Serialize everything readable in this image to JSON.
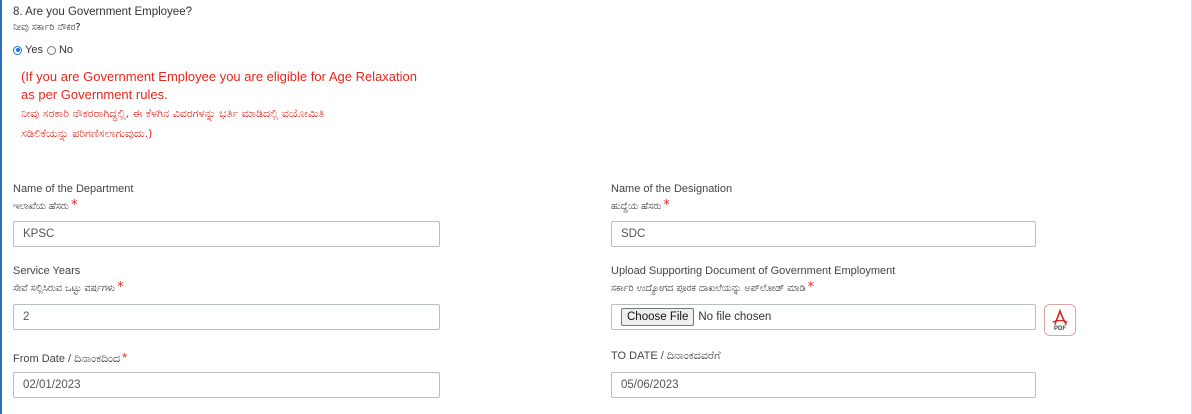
{
  "question": {
    "label": "8. Are you Government Employee?",
    "label_kn": "ನೀವು ಸರ್ಕಾರಿ ನೌಕರ?",
    "options": [
      {
        "label": "Yes",
        "checked": true
      },
      {
        "label": "No",
        "checked": false
      }
    ]
  },
  "notice": {
    "line1": "(If you are Government Employee you are eligible for Age Relaxation",
    "line2": "as per Government rules.",
    "line3": "ನೀವು ಸರಕಾರಿ ನೌಕರರಾಗಿದ್ದಲ್ಲಿ, ಈ ಕೆಳಗಿನ ವಿವರಗಳನ್ನು ಭರ್ತಿ ಮಾಡಿದಲ್ಲಿ ವಯೋಮಿತಿ",
    "line4": "ಸಡಿಲಿಕೆಯನ್ನು ಪರಿಗಣಿಸಲಾಗುವುದು.)"
  },
  "fields": {
    "department": {
      "label": "Name of the Department",
      "label_kn": "ಇಲಾಖೆಯ ಹೆಸರು",
      "required": "*",
      "value": "KPSC"
    },
    "designation": {
      "label": "Name of the Designation",
      "label_kn": "ಹುದ್ದೆಯ ಹೆಸರು",
      "required": "*",
      "value": "SDC"
    },
    "service_years": {
      "label": "Service Years",
      "label_kn": "ಸೇವೆ ಸಲ್ಲಿಸಿರುವ ಒಟ್ಟು ವರ್ಷಗಳು",
      "required": "*",
      "value": "2"
    },
    "upload": {
      "label": "Upload Supporting Document of Government Employment",
      "label_kn": "ಸರ್ಕಾರಿ ಉದ್ಯೋಗದ ಪೂರಕ ದಾಖಲೆಯನ್ನು ಅಪ್‌ಲೋಡ್ ಮಾಡಿ",
      "required": "*",
      "button": "Choose File",
      "status": "No file chosen",
      "icon_text": "PDF"
    },
    "from_date": {
      "label": "From Date / ದಿನಾಂಕದಿಂದ",
      "required": "*",
      "value": "02/01/2023"
    },
    "to_date": {
      "label": "TO DATE / ದಿನಾಂಕದವರೆಗೆ",
      "value": "05/06/2023"
    }
  },
  "colors": {
    "accent": "#1a73e8",
    "required": "#e8261c",
    "notice": "#e8261c",
    "left_border": "#2f6fb5"
  }
}
